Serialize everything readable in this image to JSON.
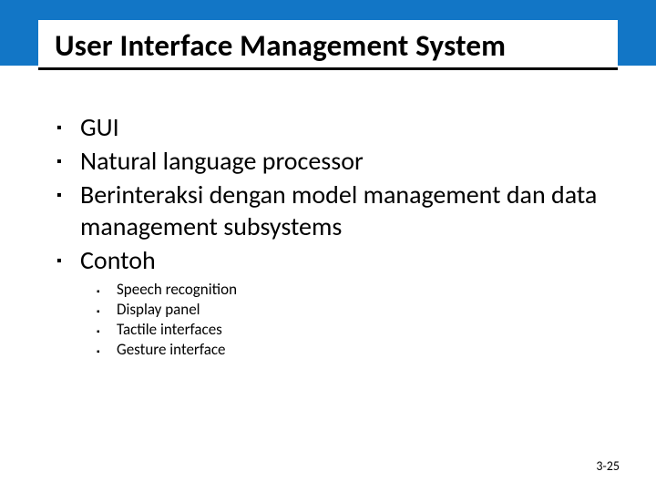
{
  "title": "User Interface Management System",
  "bullets": [
    {
      "text": "GUI"
    },
    {
      "text": "Natural language processor"
    },
    {
      "text": "Berinteraksi dengan model management dan data management subsystems"
    },
    {
      "text": "Contoh"
    }
  ],
  "sub_bullets": [
    {
      "text": "Speech recognition"
    },
    {
      "text": "Display panel"
    },
    {
      "text": "Tactile interfaces"
    },
    {
      "text": "Gesture interface"
    }
  ],
  "footer": "3-25"
}
